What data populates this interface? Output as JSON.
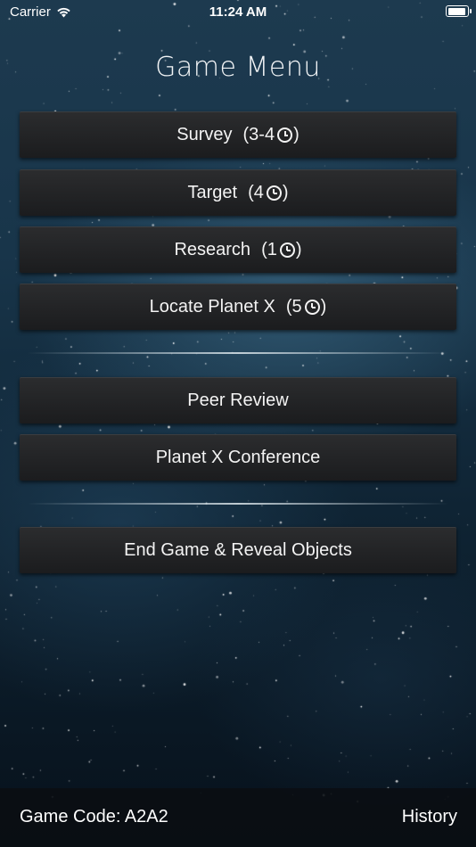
{
  "status_bar": {
    "carrier": "Carrier",
    "time": "11:24 AM"
  },
  "title": "Game Menu",
  "actions": [
    {
      "label": "Survey",
      "cost": "3-4"
    },
    {
      "label": "Target",
      "cost": "4"
    },
    {
      "label": "Research",
      "cost": "1"
    },
    {
      "label": "Locate Planet X",
      "cost": "5"
    }
  ],
  "secondary": [
    {
      "label": "Peer Review"
    },
    {
      "label": "Planet X Conference"
    }
  ],
  "end_game": {
    "label": "End Game & Reveal Objects"
  },
  "footer": {
    "game_code": "Game Code: A2A2",
    "history": "History"
  },
  "colors": {
    "button": "#232426",
    "footer": "#0a0e12",
    "text": "#f3f3f3"
  }
}
